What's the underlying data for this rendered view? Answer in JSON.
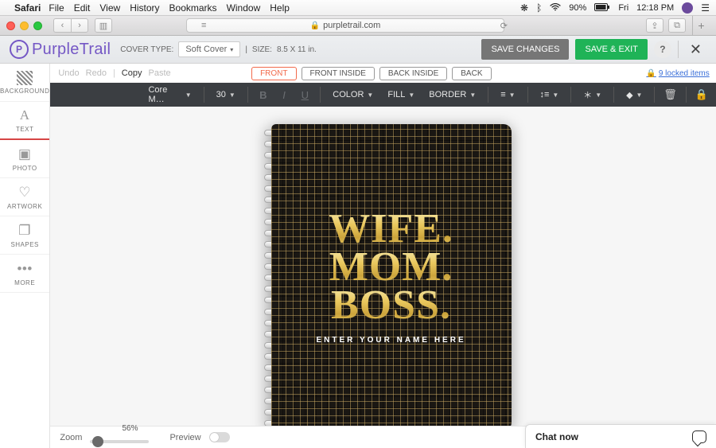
{
  "mac": {
    "app": "Safari",
    "menu": [
      "File",
      "Edit",
      "View",
      "History",
      "Bookmarks",
      "Window",
      "Help"
    ],
    "battery": "90%",
    "day": "Fri",
    "time": "12:18 PM"
  },
  "browser": {
    "url_host": "purpletrail.com"
  },
  "header": {
    "brand": "PurpleTrail",
    "cover_type_label": "COVER TYPE:",
    "cover_type_value": "Soft Cover",
    "size_label": "SIZE:",
    "size_value": "8.5 X 11 in.",
    "save_changes": "SAVE CHANGES",
    "save_exit": "SAVE & EXIT",
    "help": "?"
  },
  "rail": [
    {
      "label": "BACKGROUND",
      "icon": "hatch"
    },
    {
      "label": "TEXT",
      "icon": "A",
      "active": true
    },
    {
      "label": "PHOTO",
      "icon": "▣"
    },
    {
      "label": "ARTWORK",
      "icon": "♡"
    },
    {
      "label": "SHAPES",
      "icon": "❐"
    },
    {
      "label": "MORE",
      "icon": "•••"
    }
  ],
  "subbar": {
    "undo": "Undo",
    "redo": "Redo",
    "copy": "Copy",
    "paste": "Paste",
    "tabs": [
      "FRONT",
      "FRONT INSIDE",
      "BACK INSIDE",
      "BACK"
    ],
    "locked_count": "9 locked items"
  },
  "darkbar": {
    "font": "Core M…",
    "size": "30",
    "color": "COLOR",
    "fill": "FILL",
    "border": "BORDER"
  },
  "canvas": {
    "line1": "WIFE.",
    "line2": "MOM.",
    "line3": "BOSS.",
    "name_placeholder": "ENTER YOUR NAME HERE"
  },
  "bottom": {
    "zoom_label": "Zoom",
    "zoom_value": "56%",
    "preview_label": "Preview"
  },
  "chat": {
    "label": "Chat now"
  }
}
